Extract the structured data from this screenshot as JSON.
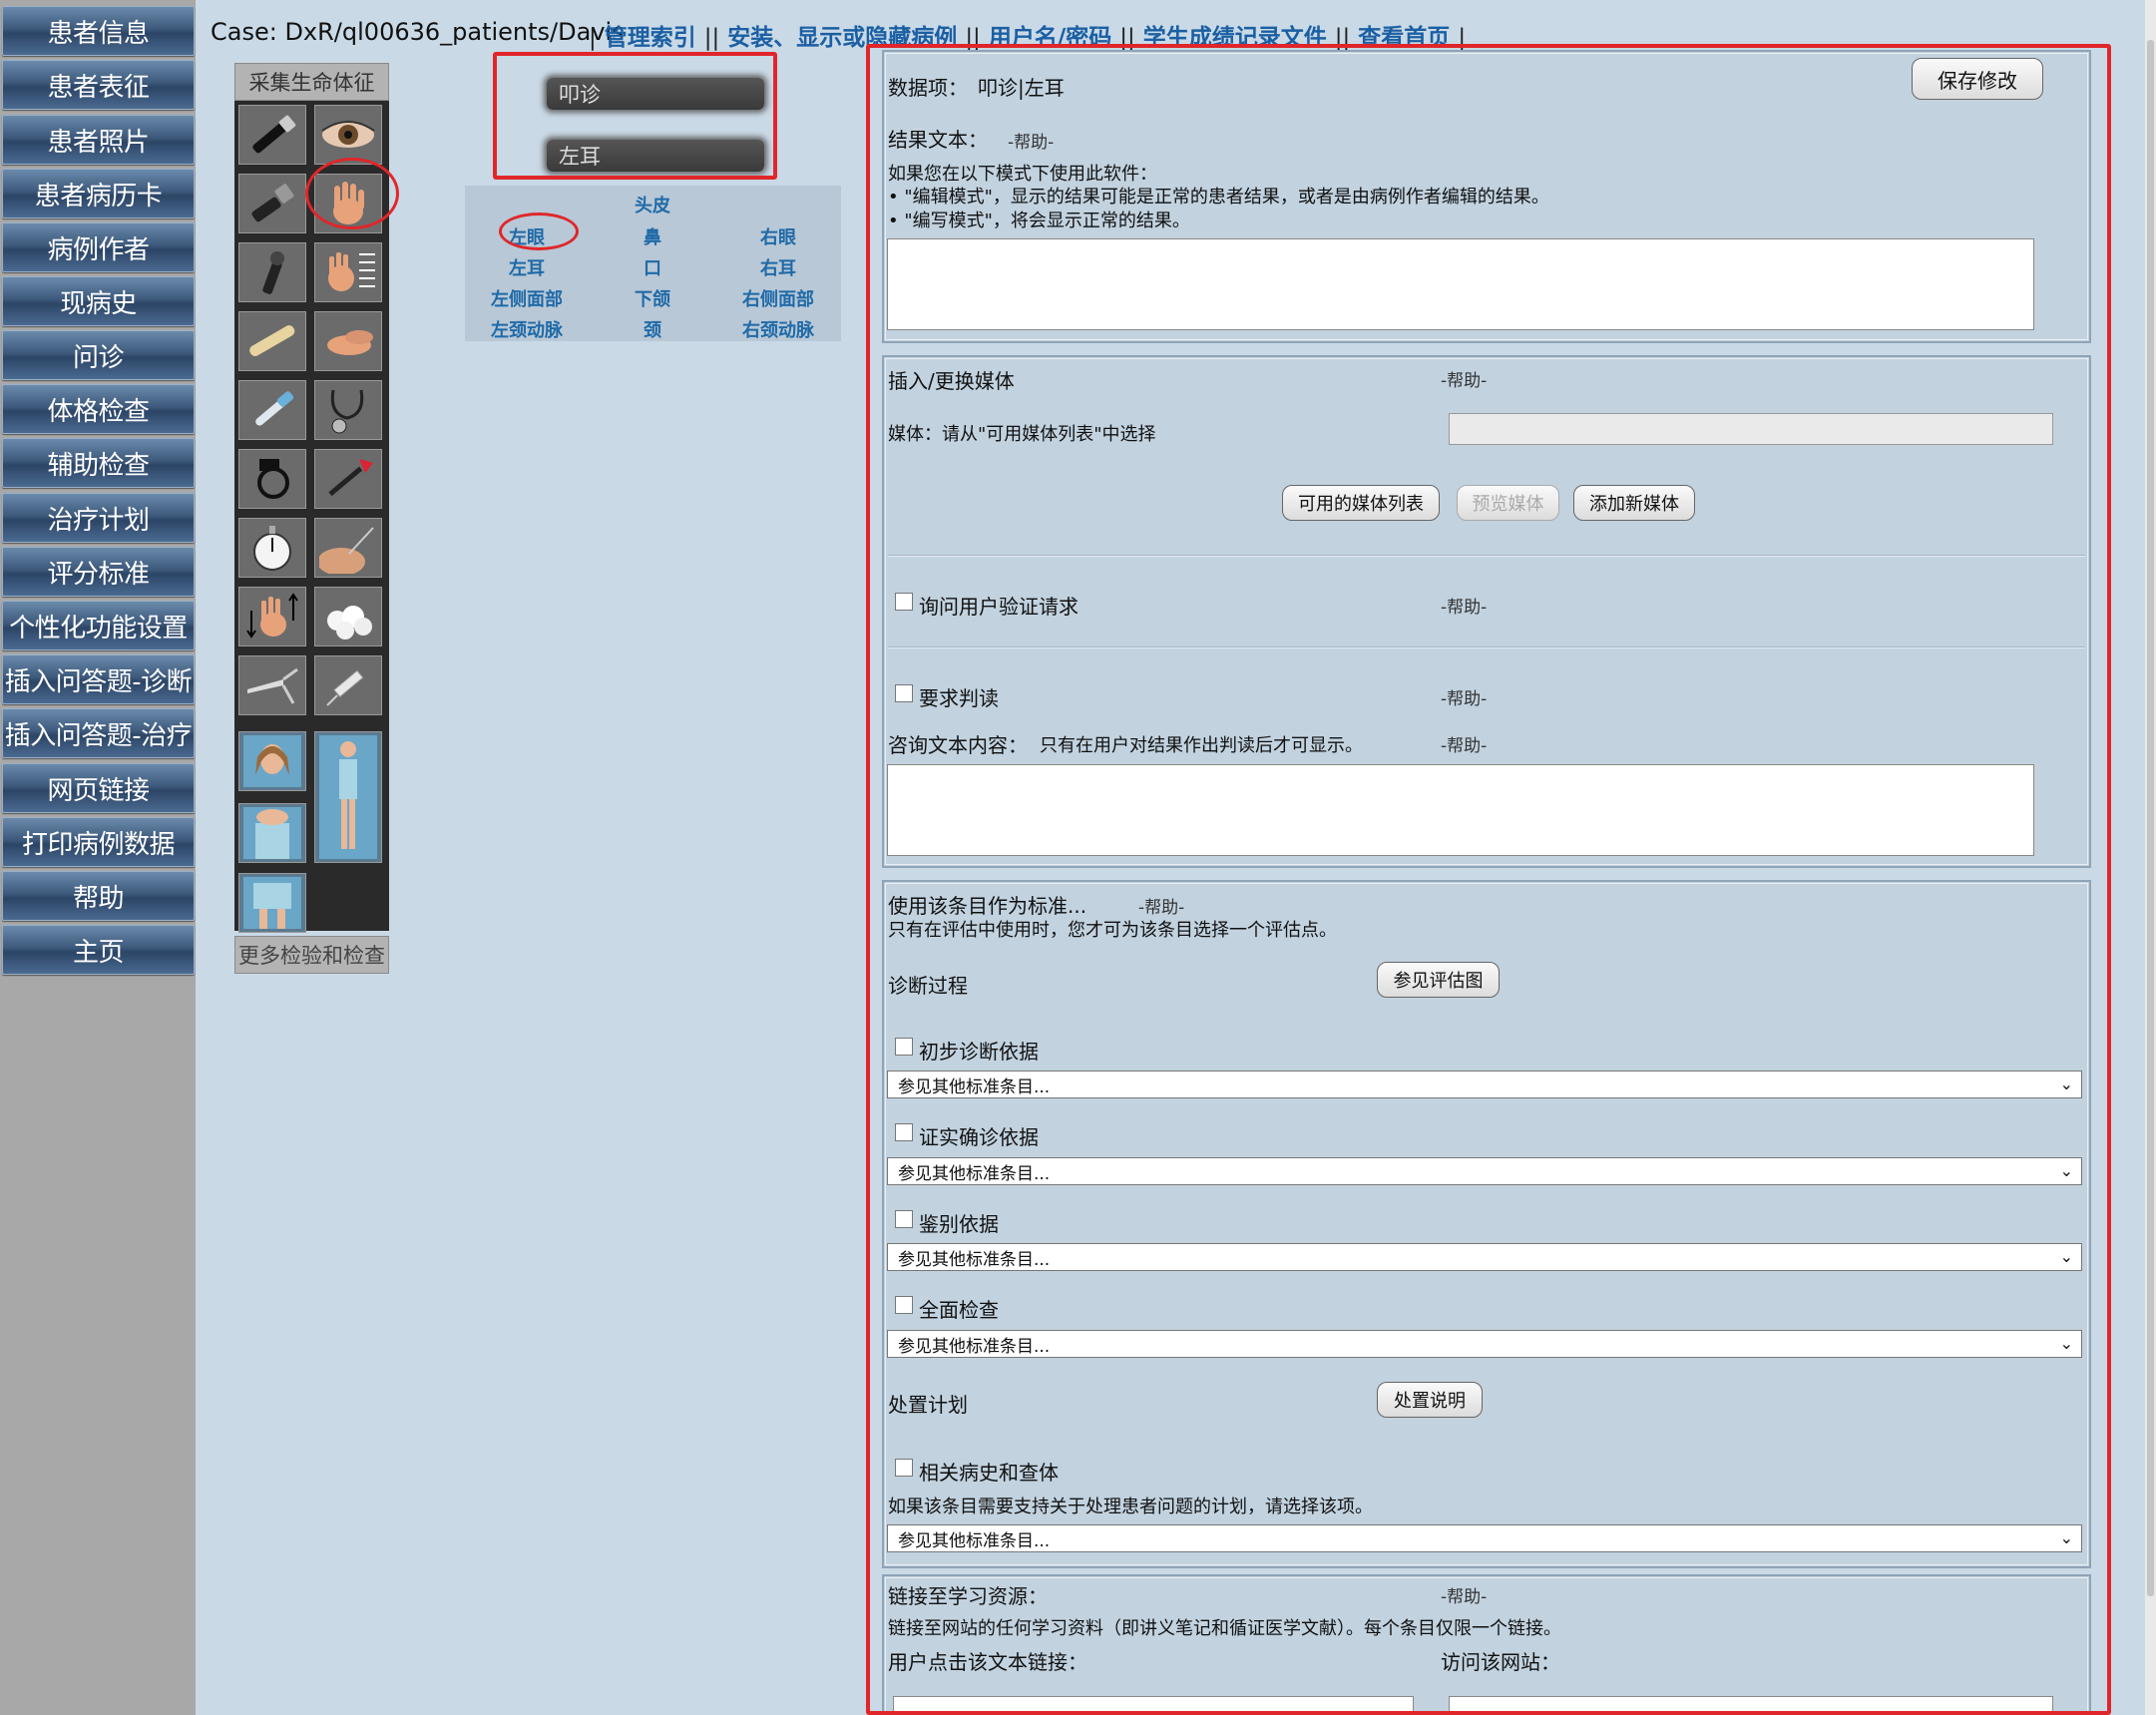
{
  "nav": [
    "患者信息",
    "患者表征",
    "患者照片",
    "患者病历卡",
    "病例作者",
    "现病史",
    "问诊",
    "体格检查",
    "辅助检查",
    "治疗计划",
    "评分标准",
    "个性化功能设置",
    "插入问答题-诊断",
    "插入问答题-治疗",
    "网页链接",
    "打印病例数据",
    "帮助",
    "主页"
  ],
  "header": {
    "case": "Case: DxR/ql00636_patients/Davis",
    "links": [
      "管理索引",
      "安装、显示或隐藏病例",
      "用户名/密码",
      "学生成绩记录文件",
      "查看首页"
    ]
  },
  "tools": {
    "title": "采集生命体征",
    "more": "更多检验和检查",
    "icons": [
      "flashlight-icon",
      "eye-icon",
      "otoscope-icon",
      "hand-icon",
      "ophthalmoscope-icon",
      "hand-grid-icon",
      "tongue-depressor-icon",
      "hand-palpate-icon",
      "thermometer-icon",
      "stethoscope-icon",
      "blood-pressure-icon",
      "reflex-hammer-icon",
      "stopwatch-icon",
      "needle-skin-icon",
      "hand-arrows-icon",
      "cotton-balls-icon",
      "speculum-icon",
      "syringe-icon",
      "face-photo-icon",
      "body-photo-icon",
      "torso-photo-icon",
      "lower-body-photo-icon"
    ]
  },
  "selection": {
    "exam": "叩诊",
    "location": "左耳"
  },
  "locations": {
    "top": "头皮",
    "rows": [
      [
        "左眼",
        "鼻",
        "右眼"
      ],
      [
        "左耳",
        "口",
        "右耳"
      ],
      [
        "左侧面部",
        "下颌",
        "右侧面部"
      ],
      [
        "左颈动脉",
        "颈",
        "右颈动脉"
      ]
    ]
  },
  "result_section": {
    "data_item_label": "数据项：",
    "data_item_value": "叩诊|左耳",
    "save_button": "保存修改",
    "result_text_label": "结果文本：",
    "help": "-帮助-",
    "info1": "如果您在以下模式下使用此软件：",
    "info2": "• \"编辑模式\"，显示的结果可能是正常的患者结果，或者是由病例作者编辑的结果。",
    "info3": "• \"编写模式\"，将会显示正常的结果。",
    "textarea": ""
  },
  "media_section": {
    "title": "插入/更换媒体",
    "help": "-帮助-",
    "media_label": "媒体：请从\"可用媒体列表\"中选择",
    "media_value": "",
    "buttons": [
      "可用的媒体列表",
      "预览媒体",
      "添加新媒体"
    ],
    "verify_label": "询问用户验证请求",
    "verify_help": "-帮助-",
    "interpret_label": "要求判读",
    "interpret_help": "-帮助-",
    "consult_label": "咨询文本内容：",
    "consult_note": "只有在用户对结果作出判读后才可显示。",
    "consult_help": "-帮助-",
    "consult_text": ""
  },
  "criteria_section": {
    "title": "使用该条目作为标准...",
    "help": "-帮助-",
    "note": "只有在评估中使用时，您才可为该条目选择一个评估点。",
    "diag_label": "诊断过程",
    "diag_button": "参见评估图",
    "checks": [
      "初步诊断依据",
      "证实确诊依据",
      "鉴别依据",
      "全面检查"
    ],
    "select_value": "参见其他标准条目...",
    "plan_label": "处置计划",
    "plan_button": "处置说明",
    "related_label": "相关病史和查体",
    "related_note": "如果该条目需要支持关于处理患者问题的计划，请选择该项。"
  },
  "links_section": {
    "title": "链接至学习资源：",
    "help": "-帮助-",
    "note": "链接至网站的任何学习资料（即讲义笔记和循证医学文献）。每个条目仅限一个链接。",
    "text_label": "用户点击该文本链接：",
    "site_label": "访问该网站："
  }
}
